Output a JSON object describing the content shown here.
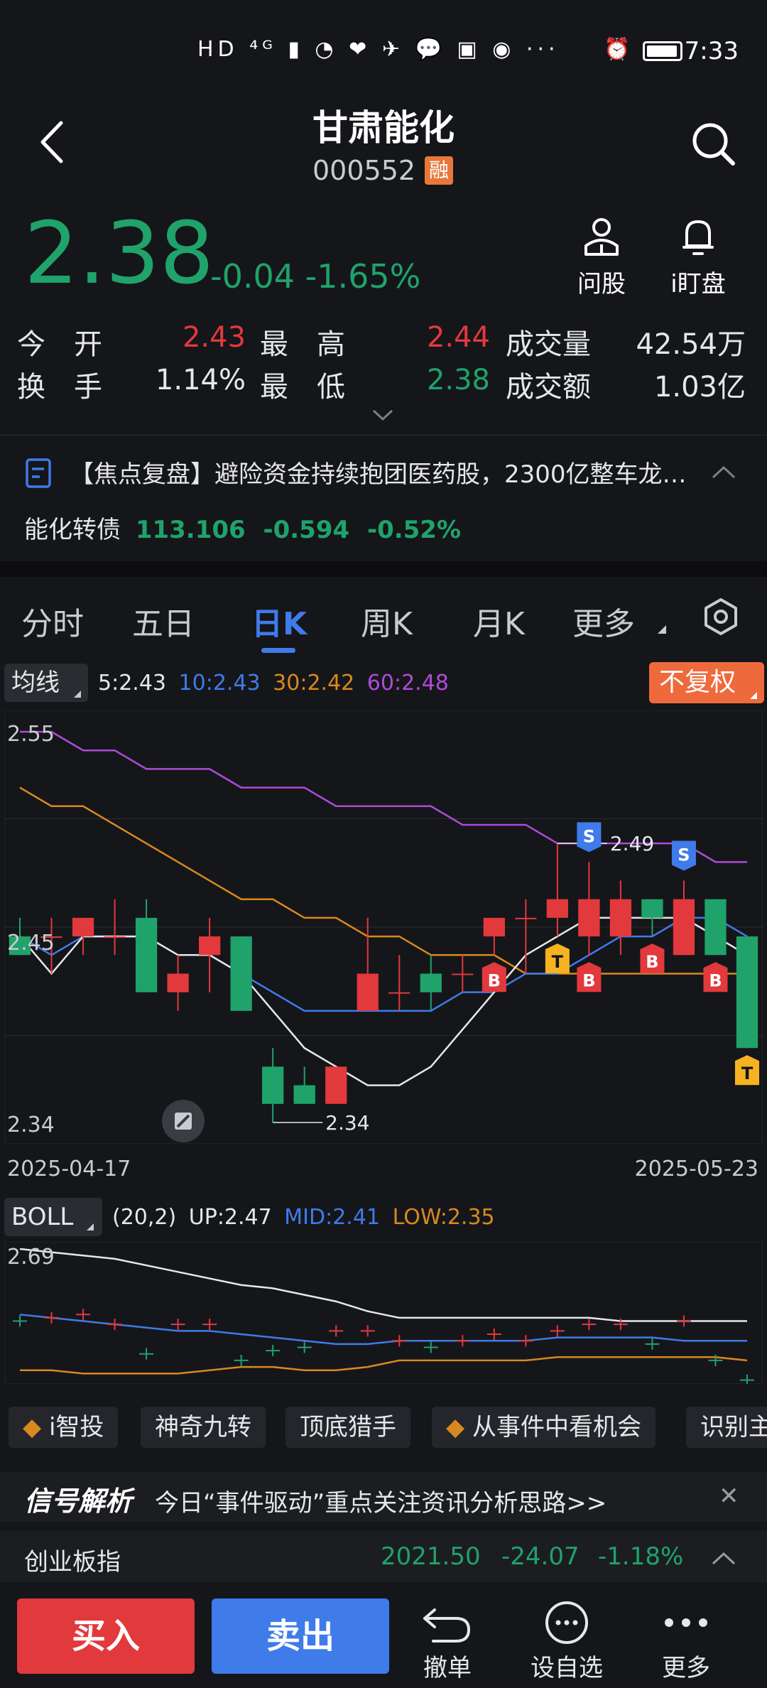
{
  "status_bar": {
    "time": "7:33",
    "left_icons": "HD ⁴ᴳ ▮ ◔ ❤ ✈ 💬 ▣ ◉ ···",
    "alarm": "⏰"
  },
  "header": {
    "title": "甘肃能化",
    "code": "000552",
    "badge": "融"
  },
  "quote": {
    "price": "2.38",
    "change": "-0.04",
    "change_pct": "-1.65%"
  },
  "tools": {
    "ask": "问股",
    "watch": "i盯盘"
  },
  "stats": {
    "open_label": "今　开",
    "open": "2.43",
    "high_label": "最　高",
    "high": "2.44",
    "volume_label": "成交量",
    "volume": "42.54万",
    "turnover_label": "换　手",
    "turnover": "1.14%",
    "low_label": "最　低",
    "low": "2.38",
    "amount_label": "成交额",
    "amount": "1.03亿"
  },
  "news": {
    "text": "【焦点复盘】避险资金持续抱团医药股，2300亿整车龙头…"
  },
  "bond": {
    "name": "能化转债",
    "price": "113.106",
    "change": "-0.594",
    "pct": "-0.52%"
  },
  "tabs": [
    "分时",
    "五日",
    "日K",
    "周K",
    "月K",
    "更多"
  ],
  "ma": {
    "label": "均线",
    "ma5": "5:2.43",
    "ma10": "10:2.43",
    "ma30": "30:2.42",
    "ma60": "60:2.48",
    "adjust": "不复权"
  },
  "colors": {
    "up": "#e2393d",
    "down": "#1fa36b",
    "ma5": "#e6e7ea",
    "ma10": "#3f7be9",
    "ma30": "#d8891e",
    "ma60": "#b04ad8",
    "accent": "#3f7be9",
    "T": "#f5b321",
    "S": "#3f7be9"
  },
  "chart_data": [
    {
      "type": "candlestick",
      "y_ticks": [
        "2.55",
        "2.45",
        "2.34"
      ],
      "ylim": [
        2.34,
        2.55
      ],
      "x_start": "2025-04-17",
      "x_end": "2025-05-23",
      "high_annotation": "2.49",
      "low_annotation": "2.34",
      "candles": [
        {
          "o": 2.44,
          "c": 2.43,
          "h": 2.45,
          "l": 2.43
        },
        {
          "o": 2.44,
          "c": 2.44,
          "h": 2.45,
          "l": 2.42
        },
        {
          "o": 2.44,
          "c": 2.45,
          "h": 2.45,
          "l": 2.43
        },
        {
          "o": 2.44,
          "c": 2.44,
          "h": 2.46,
          "l": 2.43
        },
        {
          "o": 2.45,
          "c": 2.41,
          "h": 2.46,
          "l": 2.41
        },
        {
          "o": 2.41,
          "c": 2.42,
          "h": 2.43,
          "l": 2.4
        },
        {
          "o": 2.43,
          "c": 2.44,
          "h": 2.45,
          "l": 2.41
        },
        {
          "o": 2.44,
          "c": 2.4,
          "h": 2.44,
          "l": 2.4
        },
        {
          "o": 2.37,
          "c": 2.35,
          "h": 2.38,
          "l": 2.34
        },
        {
          "o": 2.36,
          "c": 2.35,
          "h": 2.37,
          "l": 2.35
        },
        {
          "o": 2.35,
          "c": 2.37,
          "h": 2.37,
          "l": 2.35
        },
        {
          "o": 2.4,
          "c": 2.42,
          "h": 2.45,
          "l": 2.4
        },
        {
          "o": 2.41,
          "c": 2.41,
          "h": 2.43,
          "l": 2.4
        },
        {
          "o": 2.42,
          "c": 2.41,
          "h": 2.43,
          "l": 2.4
        },
        {
          "o": 2.42,
          "c": 2.42,
          "h": 2.43,
          "l": 2.41
        },
        {
          "o": 2.44,
          "c": 2.45,
          "h": 2.45,
          "l": 2.43
        },
        {
          "o": 2.45,
          "c": 2.45,
          "h": 2.46,
          "l": 2.42
        },
        {
          "o": 2.45,
          "c": 2.46,
          "h": 2.49,
          "l": 2.44
        },
        {
          "o": 2.44,
          "c": 2.46,
          "h": 2.48,
          "l": 2.43
        },
        {
          "o": 2.44,
          "c": 2.46,
          "h": 2.47,
          "l": 2.43
        },
        {
          "o": 2.46,
          "c": 2.45,
          "h": 2.46,
          "l": 2.44
        },
        {
          "o": 2.43,
          "c": 2.46,
          "h": 2.47,
          "l": 2.43
        },
        {
          "o": 2.46,
          "c": 2.43,
          "h": 2.46,
          "l": 2.43
        },
        {
          "o": 2.44,
          "c": 2.38,
          "h": 2.44,
          "l": 2.38
        }
      ],
      "ma5": [
        2.44,
        2.42,
        2.44,
        2.44,
        2.44,
        2.43,
        2.43,
        2.42,
        2.4,
        2.38,
        2.37,
        2.36,
        2.36,
        2.37,
        2.39,
        2.41,
        2.43,
        2.44,
        2.45,
        2.45,
        2.45,
        2.45,
        2.44,
        2.43
      ],
      "ma10": [
        2.44,
        2.43,
        2.44,
        2.44,
        2.44,
        2.43,
        2.43,
        2.42,
        2.41,
        2.4,
        2.4,
        2.4,
        2.4,
        2.4,
        2.41,
        2.41,
        2.42,
        2.42,
        2.43,
        2.44,
        2.44,
        2.45,
        2.45,
        2.44
      ],
      "ma30": [
        2.52,
        2.51,
        2.51,
        2.5,
        2.49,
        2.48,
        2.47,
        2.46,
        2.46,
        2.45,
        2.45,
        2.44,
        2.44,
        2.43,
        2.43,
        2.43,
        2.42,
        2.42,
        2.42,
        2.42,
        2.42,
        2.42,
        2.42,
        2.42
      ],
      "ma60": [
        2.55,
        2.55,
        2.54,
        2.54,
        2.53,
        2.53,
        2.53,
        2.52,
        2.52,
        2.52,
        2.51,
        2.51,
        2.51,
        2.51,
        2.5,
        2.5,
        2.5,
        2.49,
        2.49,
        2.49,
        2.49,
        2.49,
        2.48,
        2.48
      ],
      "signals": [
        {
          "i": 15,
          "tag": "B",
          "pos": "below"
        },
        {
          "i": 17,
          "tag": "T",
          "pos": "below"
        },
        {
          "i": 18,
          "tag": "S",
          "pos": "above"
        },
        {
          "i": 18,
          "tag": "B",
          "pos": "below"
        },
        {
          "i": 20,
          "tag": "B",
          "pos": "below"
        },
        {
          "i": 21,
          "tag": "S",
          "pos": "above"
        },
        {
          "i": 22,
          "tag": "B",
          "pos": "below"
        },
        {
          "i": 23,
          "tag": "T",
          "pos": "below"
        }
      ]
    },
    {
      "type": "line",
      "label": "BOLL",
      "params": "(20,2)",
      "up_label": "UP:2.47",
      "mid_label": "MID:2.41",
      "low_label": "LOW:2.35",
      "y_tick": "2.69",
      "ylim": [
        2.3,
        2.69
      ],
      "up": [
        2.69,
        2.68,
        2.67,
        2.66,
        2.64,
        2.62,
        2.6,
        2.58,
        2.57,
        2.55,
        2.53,
        2.5,
        2.48,
        2.48,
        2.48,
        2.48,
        2.48,
        2.48,
        2.48,
        2.47,
        2.47,
        2.47,
        2.47,
        2.47
      ],
      "mid": [
        2.49,
        2.48,
        2.47,
        2.46,
        2.45,
        2.44,
        2.44,
        2.43,
        2.42,
        2.41,
        2.4,
        2.4,
        2.41,
        2.41,
        2.41,
        2.41,
        2.41,
        2.42,
        2.42,
        2.42,
        2.42,
        2.41,
        2.41,
        2.41
      ],
      "low": [
        2.32,
        2.32,
        2.31,
        2.31,
        2.31,
        2.31,
        2.32,
        2.33,
        2.33,
        2.32,
        2.32,
        2.33,
        2.35,
        2.35,
        2.35,
        2.35,
        2.35,
        2.36,
        2.36,
        2.36,
        2.36,
        2.36,
        2.36,
        2.35
      ]
    }
  ],
  "strategies": [
    "i智投",
    "神奇九转",
    "顶底猎手",
    "从事件中看机会",
    "识别主力"
  ],
  "signal": {
    "title": "信号解析",
    "text": "今日“事件驱动”重点关注资讯分析思路>>"
  },
  "index": {
    "name": "创业板指",
    "value": "2021.50",
    "change": "-24.07",
    "pct": "-1.18%"
  },
  "bottom": {
    "buy": "买入",
    "sell": "卖出",
    "cancel": "撤单",
    "watchlist": "设自选",
    "more": "更多"
  }
}
